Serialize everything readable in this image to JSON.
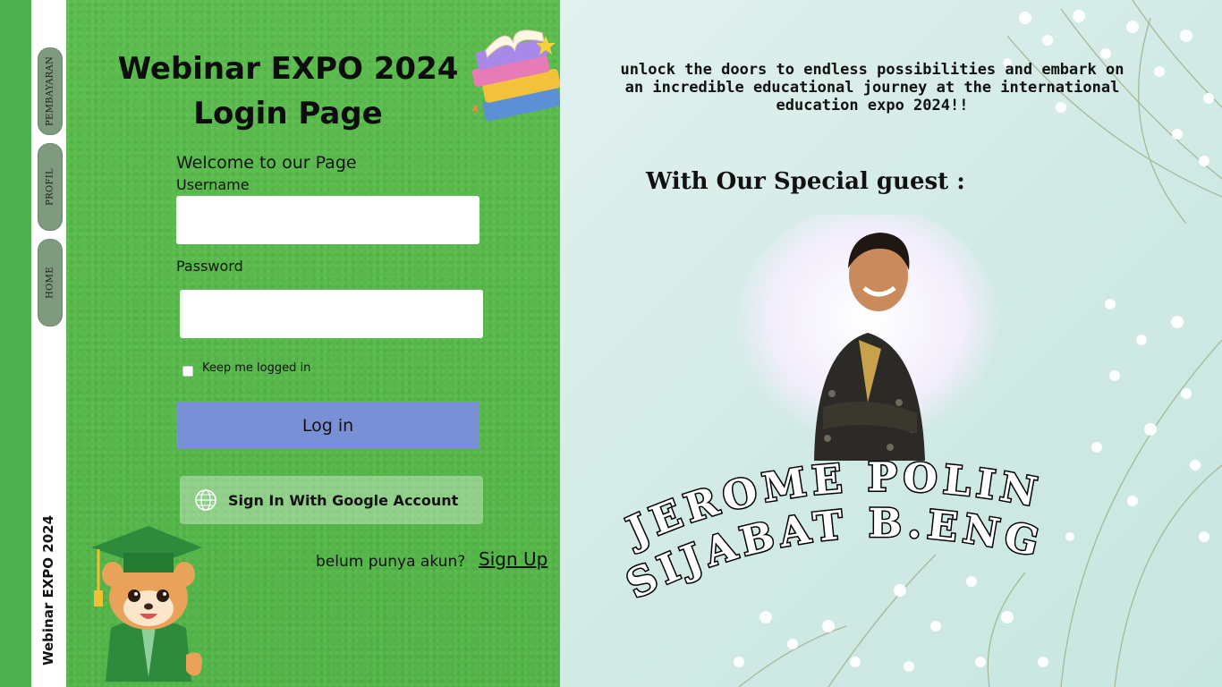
{
  "sidebar": {
    "title": "Webinar EXPO 2024",
    "items": [
      {
        "label": "PEMBAYARAN"
      },
      {
        "label": "PROFIL"
      },
      {
        "label": "HOME"
      }
    ]
  },
  "login": {
    "title_line1": "Webinar EXPO 2024",
    "title_line2": "Login Page",
    "welcome": "Welcome to our Page",
    "username_label": "Username",
    "username_value": "",
    "password_label": "Password",
    "password_value": "",
    "remember_label": "Keep me logged in",
    "login_button": "Log in",
    "google_button": "Sign In With Google Account",
    "signup_prompt": "belum punya akun?",
    "signup_link": "Sign Up"
  },
  "promo": {
    "tagline": "unlock the doors to endless possibilities and embark on an incredible educational journey at the international education expo 2024!!",
    "guest_heading": "With Our Special guest :",
    "speaker_line1": "JEROME POLIN",
    "speaker_line2": "SIJABAT B.ENG"
  },
  "colors": {
    "panel_green": "#52b447",
    "login_button": "#7a90d6",
    "nav_pill": "#7f9a7f",
    "promo_bg": "#d6ece8"
  }
}
